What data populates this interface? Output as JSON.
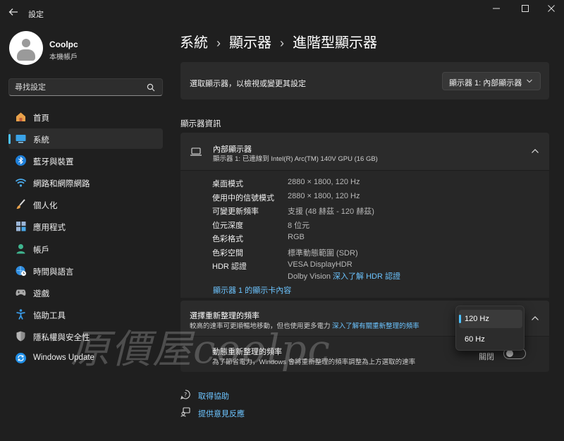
{
  "window": {
    "title": "設定"
  },
  "profile": {
    "name": "Coolpc",
    "account_type": "本機帳戶"
  },
  "search": {
    "placeholder": "尋找設定"
  },
  "nav": {
    "items": [
      {
        "label": "首頁",
        "icon": "home-icon"
      },
      {
        "label": "系統",
        "icon": "monitor-icon",
        "active": true
      },
      {
        "label": "藍牙與裝置",
        "icon": "bluetooth-icon"
      },
      {
        "label": "網路和網際網路",
        "icon": "wifi-icon"
      },
      {
        "label": "個人化",
        "icon": "brush-icon"
      },
      {
        "label": "應用程式",
        "icon": "apps-icon"
      },
      {
        "label": "帳戶",
        "icon": "person-icon"
      },
      {
        "label": "時間與語言",
        "icon": "globe-clock-icon"
      },
      {
        "label": "遊戲",
        "icon": "gamepad-icon"
      },
      {
        "label": "協助工具",
        "icon": "accessibility-icon"
      },
      {
        "label": "隱私權與安全性",
        "icon": "shield-icon"
      },
      {
        "label": "Windows Update",
        "icon": "windows-update-icon"
      }
    ]
  },
  "breadcrumb": {
    "level1": "系統",
    "level2": "顯示器",
    "level3": "進階型顯示器"
  },
  "selector": {
    "text": "選取顯示器，以檢視或變更其設定",
    "dropdown_value": "顯示器 1: 內部顯示器"
  },
  "display_info": {
    "section_title": "顯示器資訊",
    "title": "內部顯示器",
    "subtitle": "顯示器 1: 已連線到 Intel(R) Arc(TM) 140V GPU (16 GB)",
    "rows": [
      {
        "key": "桌面模式",
        "value": "2880 × 1800, 120 Hz"
      },
      {
        "key": "使用中的信號模式",
        "value": "2880 × 1800, 120 Hz"
      },
      {
        "key": "可變更新頻率",
        "value": "支援 (48 赫茲 - 120 赫茲)"
      },
      {
        "key": "位元深度",
        "value": "8 位元"
      },
      {
        "key": "色彩格式",
        "value": "RGB"
      },
      {
        "key": "色彩空間",
        "value": "標準動態範圍 (SDR)"
      },
      {
        "key": "HDR 認證",
        "value": "VESA DisplayHDR"
      }
    ],
    "hdr_line2_prefix": "Dolby Vision",
    "hdr_link": "深入了解 HDR 認證",
    "adapter_link": "顯示器 1 的顯示卡內容"
  },
  "refresh": {
    "title": "選擇重新整理的頻率",
    "subtitle": "較高的速率可更順暢地移動，但也使用更多電力",
    "learn_link": "深入了解有關重新整理的頻率",
    "options": [
      "120 Hz",
      "60 Hz"
    ],
    "selected": "120 Hz"
  },
  "dynamic_refresh": {
    "title": "動態重新整理的頻率",
    "subtitle": "為了節省電力，Windows 會將重新整理的頻率調整為上方選取的速率",
    "toggle_label": "關閉"
  },
  "help": {
    "get_help": "取得協助",
    "feedback": "提供意見反應"
  },
  "watermark": "原價屋coolpc",
  "colors": {
    "accent": "#4cc2ff",
    "link": "#6cc4ff",
    "background": "#1f1f1f",
    "card": "#2b2b2b"
  }
}
